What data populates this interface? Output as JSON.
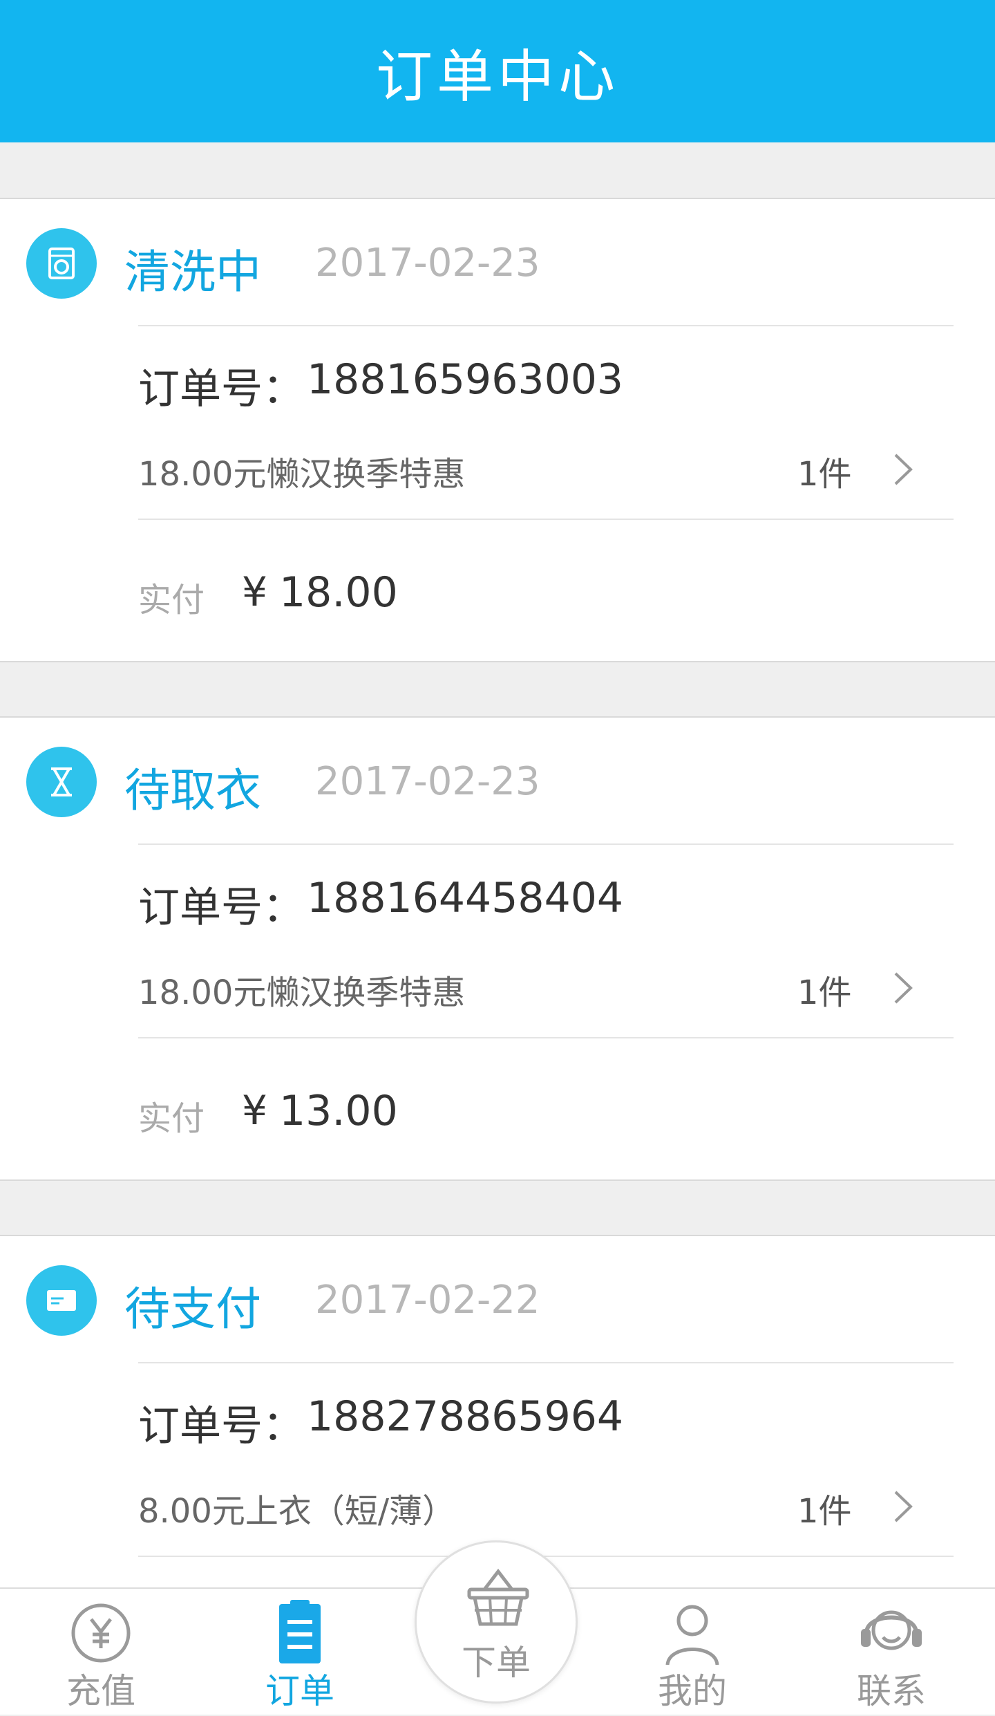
{
  "header": {
    "title": "订单中心"
  },
  "orders": [
    {
      "status": "清洗中",
      "status_icon": "washing-machine-icon",
      "date": "2017-02-23",
      "order_no_label": "订单号：",
      "order_no": "188165963003",
      "item": "18.00元懒汉换季特惠",
      "qty": "1件",
      "paid_label": "实付",
      "currency": "¥",
      "paid": "18.00"
    },
    {
      "status": "待取衣",
      "status_icon": "hourglass-icon",
      "date": "2017-02-23",
      "order_no_label": "订单号：",
      "order_no": "188164458404",
      "item": "18.00元懒汉换季特惠",
      "qty": "1件",
      "paid_label": "实付",
      "currency": "¥",
      "paid": "13.00"
    },
    {
      "status": "待支付",
      "status_icon": "card-icon",
      "date": "2017-02-22",
      "order_no_label": "订单号：",
      "order_no": "188278865964",
      "item": "8.00元上衣（短/薄）",
      "qty": "1件"
    }
  ],
  "tabbar": {
    "recharge": "充值",
    "orders": "订单",
    "place_order": "下单",
    "mine": "我的",
    "contact": "联系"
  },
  "colors": {
    "brand": "#12b5f0",
    "status_text": "#12a6e0",
    "status_icon_bg": "#2fc3ec"
  }
}
